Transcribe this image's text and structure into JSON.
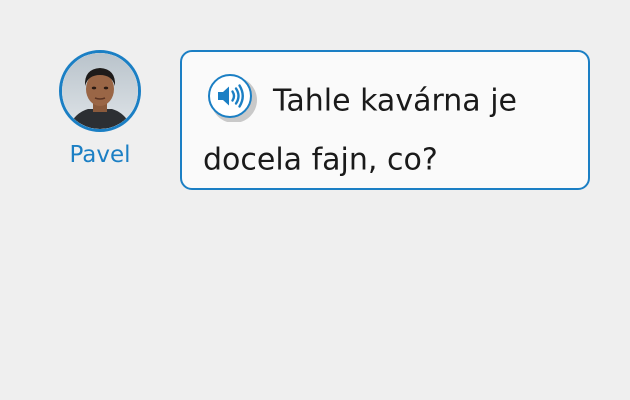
{
  "speaker": {
    "name": "Pavel",
    "accent_color": "#1b7fc4"
  },
  "message": {
    "audio_icon": "speaker-volume-icon",
    "text": "Tahle kavárna je docela fajn, co?"
  }
}
